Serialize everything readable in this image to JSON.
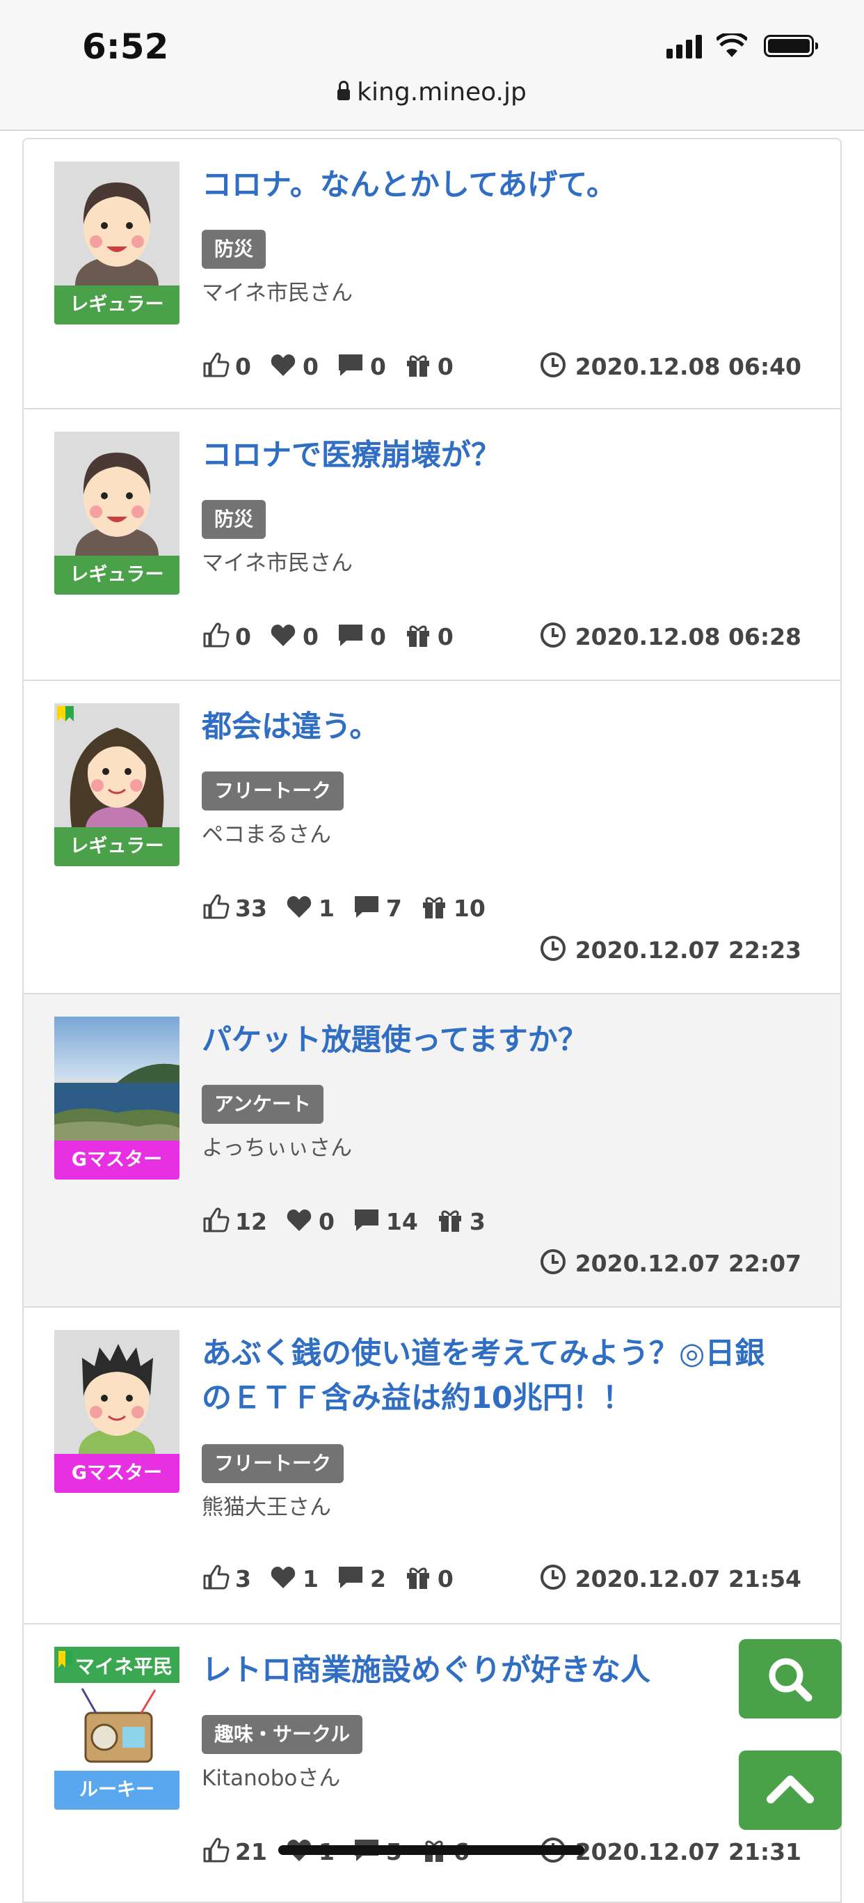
{
  "status_bar": {
    "time": "6:52"
  },
  "browser": {
    "url": "king.mineo.jp"
  },
  "posts": [
    {
      "title": "コロナ。なんとかしてあげて。",
      "tag": "防災",
      "author": "マイネ市民さん",
      "rank": "レギュラー",
      "likes": "0",
      "hearts": "0",
      "comments": "0",
      "gifts": "0",
      "date": "2020.12.08 06:40"
    },
    {
      "title": "コロナで医療崩壊が？",
      "tag": "防災",
      "author": "マイネ市民さん",
      "rank": "レギュラー",
      "likes": "0",
      "hearts": "0",
      "comments": "0",
      "gifts": "0",
      "date": "2020.12.08 06:28"
    },
    {
      "title": "都会は違う。",
      "tag": "フリートーク",
      "author": "ペコまるさん",
      "rank": "レギュラー",
      "likes": "33",
      "hearts": "1",
      "comments": "7",
      "gifts": "10",
      "date": "2020.12.07 22:23"
    },
    {
      "title": "パケット放題使ってますか？",
      "tag": "アンケート",
      "author": "よっちぃぃさん",
      "rank": "Gマスター",
      "likes": "12",
      "hearts": "0",
      "comments": "14",
      "gifts": "3",
      "date": "2020.12.07 22:07"
    },
    {
      "title_line1": "あぶく銭の使い道を考えてみよう？◎日銀",
      "title_line2": "のＥＴＦ含み益は約10兆円！！",
      "tag": "フリートーク",
      "author": "熊猫大王さん",
      "rank": "Gマスター",
      "likes": "3",
      "hearts": "1",
      "comments": "2",
      "gifts": "0",
      "date": "2020.12.07 21:54"
    },
    {
      "title": "レトロ商業施設めぐりが好きな人",
      "tag": "趣味・サークル",
      "author": "Kitanoboさん",
      "rank": "ルーキー",
      "badge_text": "マイネ平民",
      "likes": "21",
      "hearts": "1",
      "comments": "5",
      "gifts": "6",
      "date": "2020.12.07 21:31"
    }
  ],
  "icons": [
    "lock-icon",
    "thumbs-up-icon",
    "heart-icon",
    "comment-icon",
    "gift-icon",
    "clock-icon",
    "search-icon",
    "chevron-up-icon"
  ],
  "colors": {
    "title": "#2f6ec2",
    "regular": "#4aa14a",
    "gmaster": "#e830e3",
    "rookie": "#59a7ef",
    "tag": "#737373",
    "fab": "#4aa14a"
  }
}
